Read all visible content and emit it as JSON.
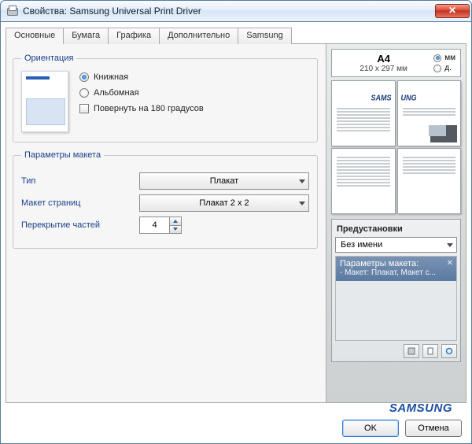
{
  "window": {
    "title": "Свойства: Samsung Universal Print Driver"
  },
  "tabs": [
    {
      "label": "Основные"
    },
    {
      "label": "Бумага"
    },
    {
      "label": "Графика"
    },
    {
      "label": "Дополнительно"
    },
    {
      "label": "Samsung"
    }
  ],
  "orientation": {
    "legend": "Ориентация",
    "options": {
      "portrait": "Книжная",
      "landscape": "Альбомная",
      "rotate": "Повернуть на 180 градусов"
    },
    "selected": "portrait"
  },
  "layout": {
    "legend": "Параметры макета",
    "labels": {
      "type": "Тип",
      "pages": "Макет страниц",
      "overlap": "Перекрытие частей"
    },
    "type_value": "Плакат",
    "pages_value": "Плакат 2 x 2",
    "overlap_value": "4"
  },
  "paper": {
    "size_big": "A4",
    "size_small": "210 x 297 мм",
    "units": {
      "mm": "мм",
      "in": "д."
    },
    "unit_selected": "mm"
  },
  "presets": {
    "header": "Предустановки",
    "dropdown": "Без имени",
    "item_title": "Параметры макета:",
    "item_sub": "- Макет: Плакат, Макет с..."
  },
  "brand": "SAMSUNG",
  "buttons": {
    "ok": "OK",
    "cancel": "Отмена"
  }
}
